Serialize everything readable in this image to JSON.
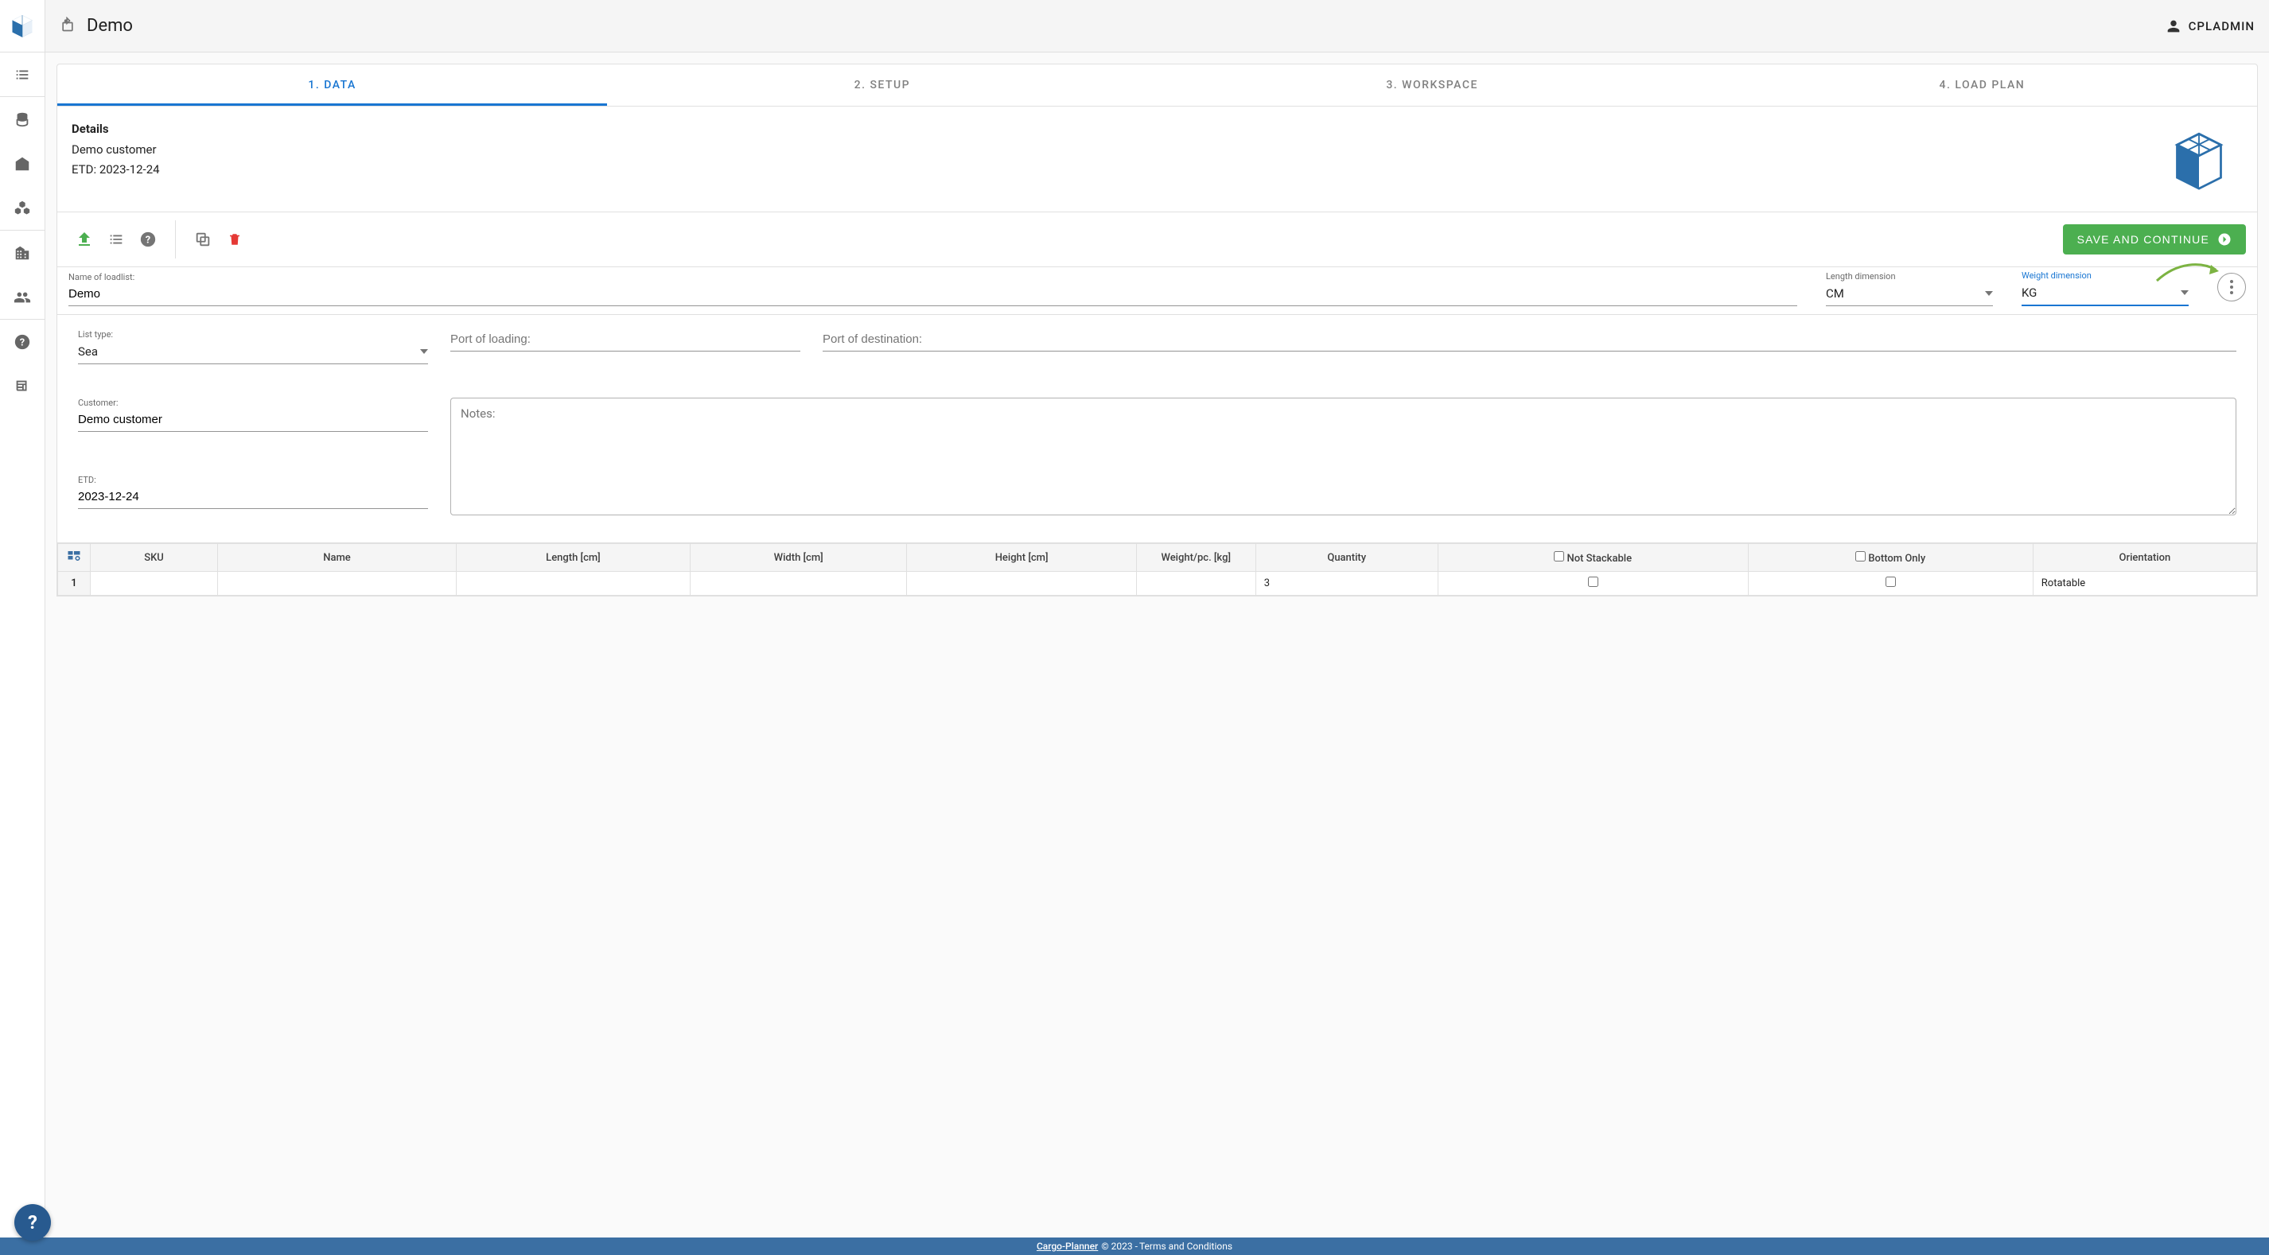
{
  "header": {
    "title": "Demo",
    "user": "CPLADMIN"
  },
  "tabs": [
    {
      "label": "1. DATA"
    },
    {
      "label": "2. SETUP"
    },
    {
      "label": "3. WORKSPACE"
    },
    {
      "label": "4. LOAD PLAN"
    }
  ],
  "details": {
    "title": "Details",
    "customer_line": "Demo customer",
    "etd_line": "ETD: 2023-12-24"
  },
  "toolbar": {
    "save_label": "SAVE AND CONTINUE"
  },
  "fields": {
    "name_label": "Name of loadlist:",
    "name_value": "Demo",
    "len_label": "Length dimension",
    "len_value": "CM",
    "wt_label": "Weight dimension",
    "wt_value": "KG",
    "list_type_label": "List type:",
    "list_type_value": "Sea",
    "pol_label": "Port of loading:",
    "pol_value": "",
    "pod_label": "Port of destination:",
    "pod_value": "",
    "customer_label": "Customer:",
    "customer_value": "Demo customer",
    "etd_label": "ETD:",
    "etd_value": "2023-12-24",
    "notes_placeholder": "Notes:"
  },
  "table": {
    "headers": {
      "sku": "SKU",
      "name": "Name",
      "length": "Length [cm]",
      "width": "Width [cm]",
      "height": "Height [cm]",
      "weight": "Weight/pc. [kg]",
      "quantity": "Quantity",
      "not_stackable": "Not Stackable",
      "bottom_only": "Bottom Only",
      "orientation": "Orientation"
    },
    "rows": [
      {
        "num": "1",
        "quantity": "3",
        "orientation": "Rotatable"
      }
    ]
  },
  "footer": {
    "link": "Cargo-Planner",
    "copyright": "© 2023 -",
    "terms": "Terms and Conditions"
  },
  "icons": {
    "upload": "upload-icon",
    "list": "list-icon",
    "help": "help-icon",
    "copy": "copy-icon",
    "delete": "trash-icon"
  }
}
